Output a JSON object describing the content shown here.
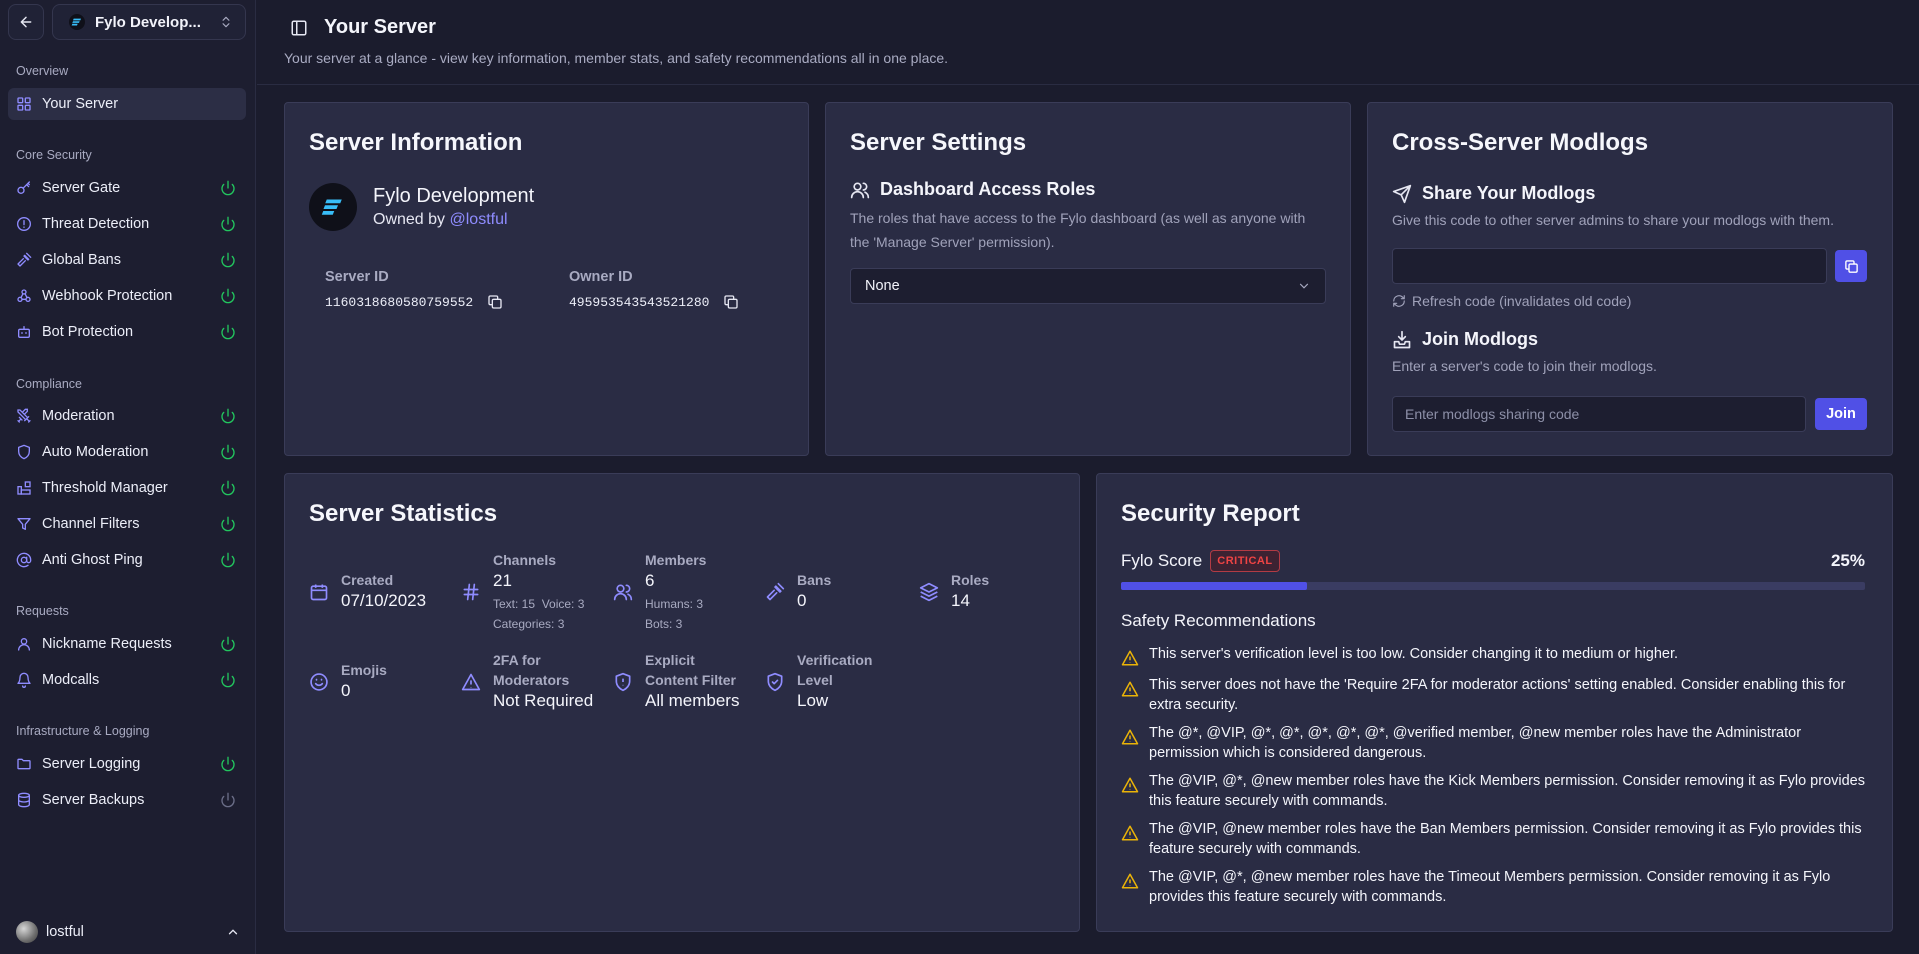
{
  "sidebar": {
    "server_name": "Fylo Develop...",
    "sections": {
      "overview": "Overview",
      "core_security": "Core Security",
      "compliance": "Compliance",
      "requests": "Requests",
      "infra": "Infrastructure & Logging"
    },
    "items": {
      "your_server": "Your Server",
      "server_gate": "Server Gate",
      "threat_detection": "Threat Detection",
      "global_bans": "Global Bans",
      "webhook_protection": "Webhook Protection",
      "bot_protection": "Bot Protection",
      "moderation": "Moderation",
      "auto_moderation": "Auto Moderation",
      "threshold_manager": "Threshold Manager",
      "channel_filters": "Channel Filters",
      "anti_ghost_ping": "Anti Ghost Ping",
      "nickname_requests": "Nickname Requests",
      "modcalls": "Modcalls",
      "server_logging": "Server Logging",
      "server_backups": "Server Backups"
    },
    "user": "lostful",
    "colors": {
      "enabled": "#22c55e",
      "disabled": "#6b6e88"
    }
  },
  "header": {
    "title": "Your Server",
    "description": "Your server at a glance - view key information, member stats, and safety recommendations all in one place."
  },
  "server_info": {
    "title": "Server Information",
    "server_name": "Fylo Development",
    "owned_by": "Owned by",
    "owner": "@lostful",
    "server_id_label": "Server ID",
    "server_id": "1160318680580759552",
    "owner_id_label": "Owner ID",
    "owner_id": "495953543543521280"
  },
  "server_settings": {
    "title": "Server Settings",
    "access_title": "Dashboard Access Roles",
    "access_desc": "The roles that have access to the Fylo dashboard (as well as anyone with the 'Manage Server' permission).",
    "selected_role": "None"
  },
  "modlogs": {
    "title": "Cross-Server Modlogs",
    "share_title": "Share Your Modlogs",
    "share_desc": "Give this code to other server admins to share your modlogs with them.",
    "share_code": "",
    "refresh": "Refresh code (invalidates old code)",
    "join_title": "Join Modlogs",
    "join_desc": "Enter a server's code to join their modlogs.",
    "join_placeholder": "Enter modlogs sharing code",
    "join_button": "Join"
  },
  "stats": {
    "title": "Server Statistics",
    "created_label": "Created",
    "created": "07/10/2023",
    "channels_label": "Channels",
    "channels": "21",
    "channels_text": "Text: 15",
    "channels_voice": "Voice: 3",
    "channels_categories": "Categories: 3",
    "members_label": "Members",
    "members": "6",
    "members_humans": "Humans: 3",
    "members_bots": "Bots: 3",
    "bans_label": "Bans",
    "bans": "0",
    "roles_label": "Roles",
    "roles": "14",
    "emojis_label": "Emojis",
    "emojis": "0",
    "twofa_label_1": "2FA for",
    "twofa_label_2": "Moderators",
    "twofa": "Not Required",
    "filter_label_1": "Explicit",
    "filter_label_2": "Content Filter",
    "filter": "All members",
    "verif_label_1": "Verification",
    "verif_label_2": "Level",
    "verif": "Low"
  },
  "security": {
    "title": "Security Report",
    "score_label": "Fylo Score",
    "badge": "CRITICAL",
    "score_text": "25%",
    "score_fraction": 0.25,
    "rec_title": "Safety Recommendations",
    "recommendations": [
      "This server's verification level is too low. Consider changing it to medium or higher.",
      "This server does not have the 'Require 2FA for moderator actions' setting enabled. Consider enabling this for extra security.",
      "The @*, @VIP, @*, @*, @*, @*, @*, @verified member, @new member roles have the Administrator permission which is considered dangerous.",
      "The @VIP, @*, @new member roles have the Kick Members permission. Consider removing it as Fylo provides this feature securely with commands.",
      "The @VIP, @new member roles have the Ban Members permission. Consider removing it as Fylo provides this feature securely with commands.",
      "The @VIP, @*, @new member roles have the Timeout Members permission. Consider removing it as Fylo provides this feature securely with commands."
    ]
  },
  "colors": {
    "accent": "#5050e6",
    "icon": "#8f8cff",
    "warning": "#eab308",
    "critical": "#ef4444"
  }
}
